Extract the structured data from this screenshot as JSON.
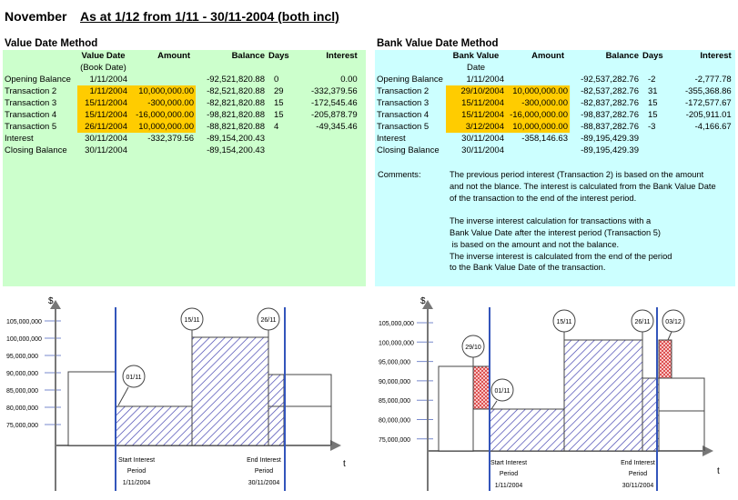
{
  "header": {
    "month": "November",
    "range": "As at 1/12 from 1/11 - 30/11-2004 (both incl)"
  },
  "left": {
    "title": "Value Date Method",
    "columns": {
      "label": "",
      "date": "Value Date",
      "amount": "Amount",
      "balance": "Balance",
      "days": "Days",
      "interest": "Interest"
    },
    "subheader": "(Book Date)",
    "rows": [
      {
        "label": "Opening Balance",
        "date": "1/11/2004",
        "amount": "",
        "balance": "-92,521,820.88",
        "days": "0",
        "interest": "0.00",
        "hl": false
      },
      {
        "label": "Transaction 2",
        "date": "1/11/2004",
        "amount": "10,000,000.00",
        "balance": "-82,521,820.88",
        "days": "29",
        "interest": "-332,379.56",
        "hl": true
      },
      {
        "label": "Transaction 3",
        "date": "15/11/2004",
        "amount": "-300,000.00",
        "balance": "-82,821,820.88",
        "days": "15",
        "interest": "-172,545.46",
        "hl": true
      },
      {
        "label": "Transaction 4",
        "date": "15/11/2004",
        "amount": "-16,000,000.00",
        "balance": "-98,821,820.88",
        "days": "15",
        "interest": "-205,878.79",
        "hl": true
      },
      {
        "label": "Transaction 5",
        "date": "26/11/2004",
        "amount": "10,000,000.00",
        "balance": "-88,821,820.88",
        "days": "4",
        "interest": "-49,345.46",
        "hl": true
      },
      {
        "label": "Interest",
        "date": "30/11/2004",
        "amount": "-332,379.56",
        "balance": "-89,154,200.43",
        "days": "",
        "interest": "",
        "hl": false
      },
      {
        "label": "Closing Balance",
        "date": "30/11/2004",
        "amount": "",
        "balance": "-89,154,200.43",
        "days": "",
        "interest": "",
        "hl": false
      }
    ]
  },
  "right": {
    "title": "Bank Value Date Method",
    "columns": {
      "label": "",
      "date": "Bank Value",
      "amount": "Amount",
      "balance": "Balance",
      "days": "Days",
      "interest": "Interest"
    },
    "subheader": "Date",
    "rows": [
      {
        "label": "Opening Balance",
        "date": "1/11/2004",
        "amount": "",
        "balance": "-92,537,282.76",
        "days": "-2",
        "interest": "-2,777.78",
        "hl": false
      },
      {
        "label": "Transaction 2",
        "date": "29/10/2004",
        "amount": "10,000,000.00",
        "balance": "-82,537,282.76",
        "days": "31",
        "interest": "-355,368.86",
        "hl": true
      },
      {
        "label": "Transaction 3",
        "date": "15/11/2004",
        "amount": "-300,000.00",
        "balance": "-82,837,282.76",
        "days": "15",
        "interest": "-172,577.67",
        "hl": true
      },
      {
        "label": "Transaction 4",
        "date": "15/11/2004",
        "amount": "-16,000,000.00",
        "balance": "-98,837,282.76",
        "days": "15",
        "interest": "-205,911.01",
        "hl": true
      },
      {
        "label": "Transaction 5",
        "date": "3/12/2004",
        "amount": "10,000,000.00",
        "balance": "-88,837,282.76",
        "days": "-3",
        "interest": "-4,166.67",
        "hl": true
      },
      {
        "label": "Interest",
        "date": "30/11/2004",
        "amount": "-358,146.63",
        "balance": "-89,195,429.39",
        "days": "",
        "interest": "",
        "hl": false
      },
      {
        "label": "Closing Balance",
        "date": "30/11/2004",
        "amount": "",
        "balance": "-89,195,429.39",
        "days": "",
        "interest": "",
        "hl": false
      }
    ],
    "comments_label": "Comments:",
    "comments": [
      "The previous period interest (Transaction 2) is based on the amount",
      "and not the blance. The interest is calculated from the Bank Value Date",
      "of the transaction to the end of the interest period.",
      "",
      "The inverse interest calculation for transactions with a",
      "Bank Value Date after the interest period (Transaction 5)",
      " is based on the amount and not the balance.",
      "The inverse interest is calculated from the end of the period",
      "to the Bank Value Date of the transaction."
    ]
  },
  "diagrams": {
    "y_axis_symbol": "$",
    "x_axis_symbol": "t",
    "y_ticks": [
      "105,000,000",
      "100,000,000",
      "95,000,000",
      "90,000,000",
      "85,000,000",
      "80,000,000",
      "75,000,000"
    ],
    "start_label": [
      "Start Interest",
      "Period"
    ],
    "start_date": "1/11/2004",
    "end_label": [
      "End Interest",
      "Period"
    ],
    "end_date": "30/11/2004",
    "left_callouts": [
      "01/11",
      "15/11",
      "26/11"
    ],
    "right_callouts": [
      "29/10",
      "01/11",
      "15/11",
      "26/11",
      "03/12"
    ]
  }
}
